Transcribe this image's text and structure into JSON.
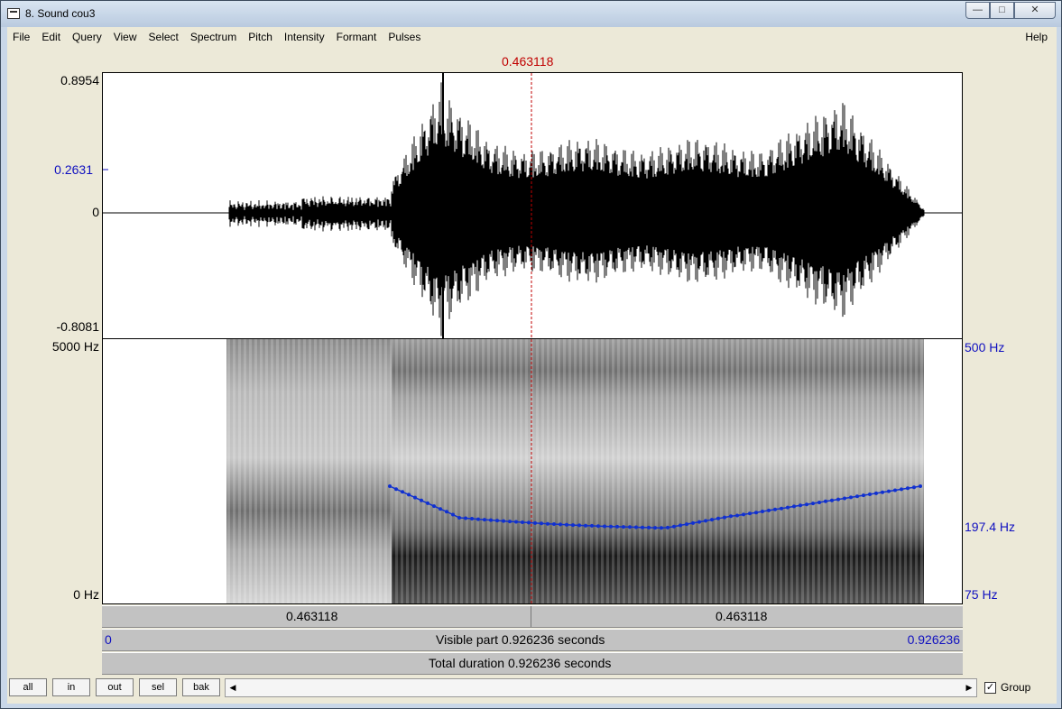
{
  "window": {
    "title": "8. Sound cou3"
  },
  "menu": {
    "items": [
      "File",
      "Edit",
      "Query",
      "View",
      "Select",
      "Spectrum",
      "Pitch",
      "Intensity",
      "Formant",
      "Pulses"
    ],
    "help": "Help"
  },
  "cursor": {
    "time_label": "0.463118",
    "color": "#c00000"
  },
  "waveform": {
    "y_max": "0.8954",
    "y_cursor": "0.2631",
    "y_zero": "0",
    "y_min": "-0.8081"
  },
  "spectrogram": {
    "freq_max": "5000 Hz",
    "freq_min": "0 Hz",
    "pitch_max": "500 Hz",
    "pitch_value": "197.4 Hz",
    "pitch_min": "75 Hz",
    "pitch_color": "#1030d0"
  },
  "time_bars": {
    "left_segment": "0.463118",
    "right_segment": "0.463118",
    "visible_start": "0",
    "visible_text": "Visible part 0.926236 seconds",
    "visible_end": "0.926236",
    "total_text": "Total duration 0.926236 seconds"
  },
  "buttons": {
    "all": "all",
    "in": "in",
    "out": "out",
    "sel": "sel",
    "bak": "bak"
  },
  "group": {
    "label": "Group",
    "checked": true
  }
}
